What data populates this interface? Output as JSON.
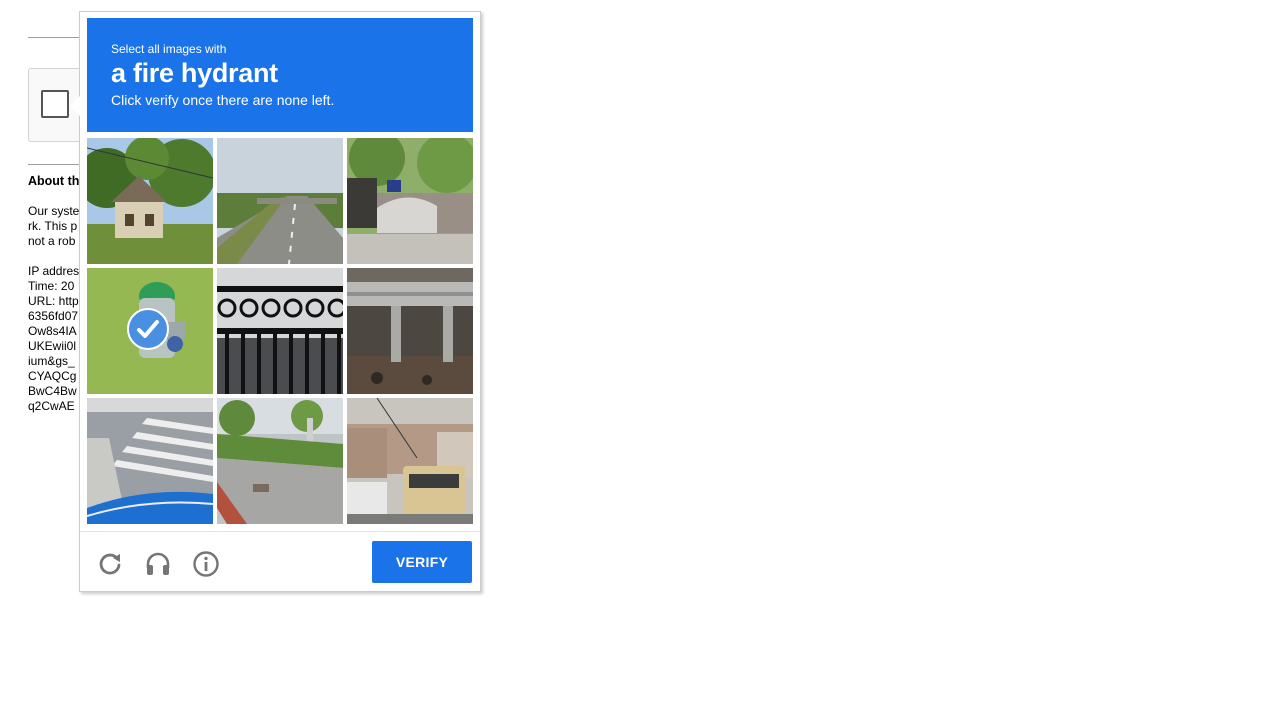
{
  "background_page": {
    "about_heading": "About th",
    "lines_group1": [
      "Our syste",
      "rk. This p",
      "not a rob"
    ],
    "lines_group2": [
      "IP addres",
      "Time: 20",
      "URL: http",
      "6356fd07",
      "Ow8s4IA",
      "UKEwii0l",
      "ium&gs_",
      "CYAQCg",
      "BwC4Bw",
      "q2CwAE"
    ]
  },
  "challenge": {
    "instruction_small": "Select all images with",
    "target_object": "a fire hydrant",
    "instruction_hint": "Click verify once there are none left.",
    "tiles": [
      {
        "content": "house with trees",
        "selected": false
      },
      {
        "content": "highway overpass",
        "selected": false
      },
      {
        "content": "fence with shrubs",
        "selected": false
      },
      {
        "content": "green fire hydrant",
        "selected": true
      },
      {
        "content": "black iron fence",
        "selected": false
      },
      {
        "content": "guardrail",
        "selected": false
      },
      {
        "content": "crosswalk with car hood",
        "selected": false
      },
      {
        "content": "sidewalk with plants",
        "selected": false
      },
      {
        "content": "street with bus",
        "selected": false
      }
    ],
    "footer": {
      "reload_icon": "reload-icon",
      "audio_icon": "headphones-icon",
      "info_icon": "info-icon",
      "verify_label": "VERIFY"
    }
  },
  "colors": {
    "accent_blue": "#1a73e8",
    "check_blue": "#4a90e2",
    "icon_gray": "#757575"
  }
}
